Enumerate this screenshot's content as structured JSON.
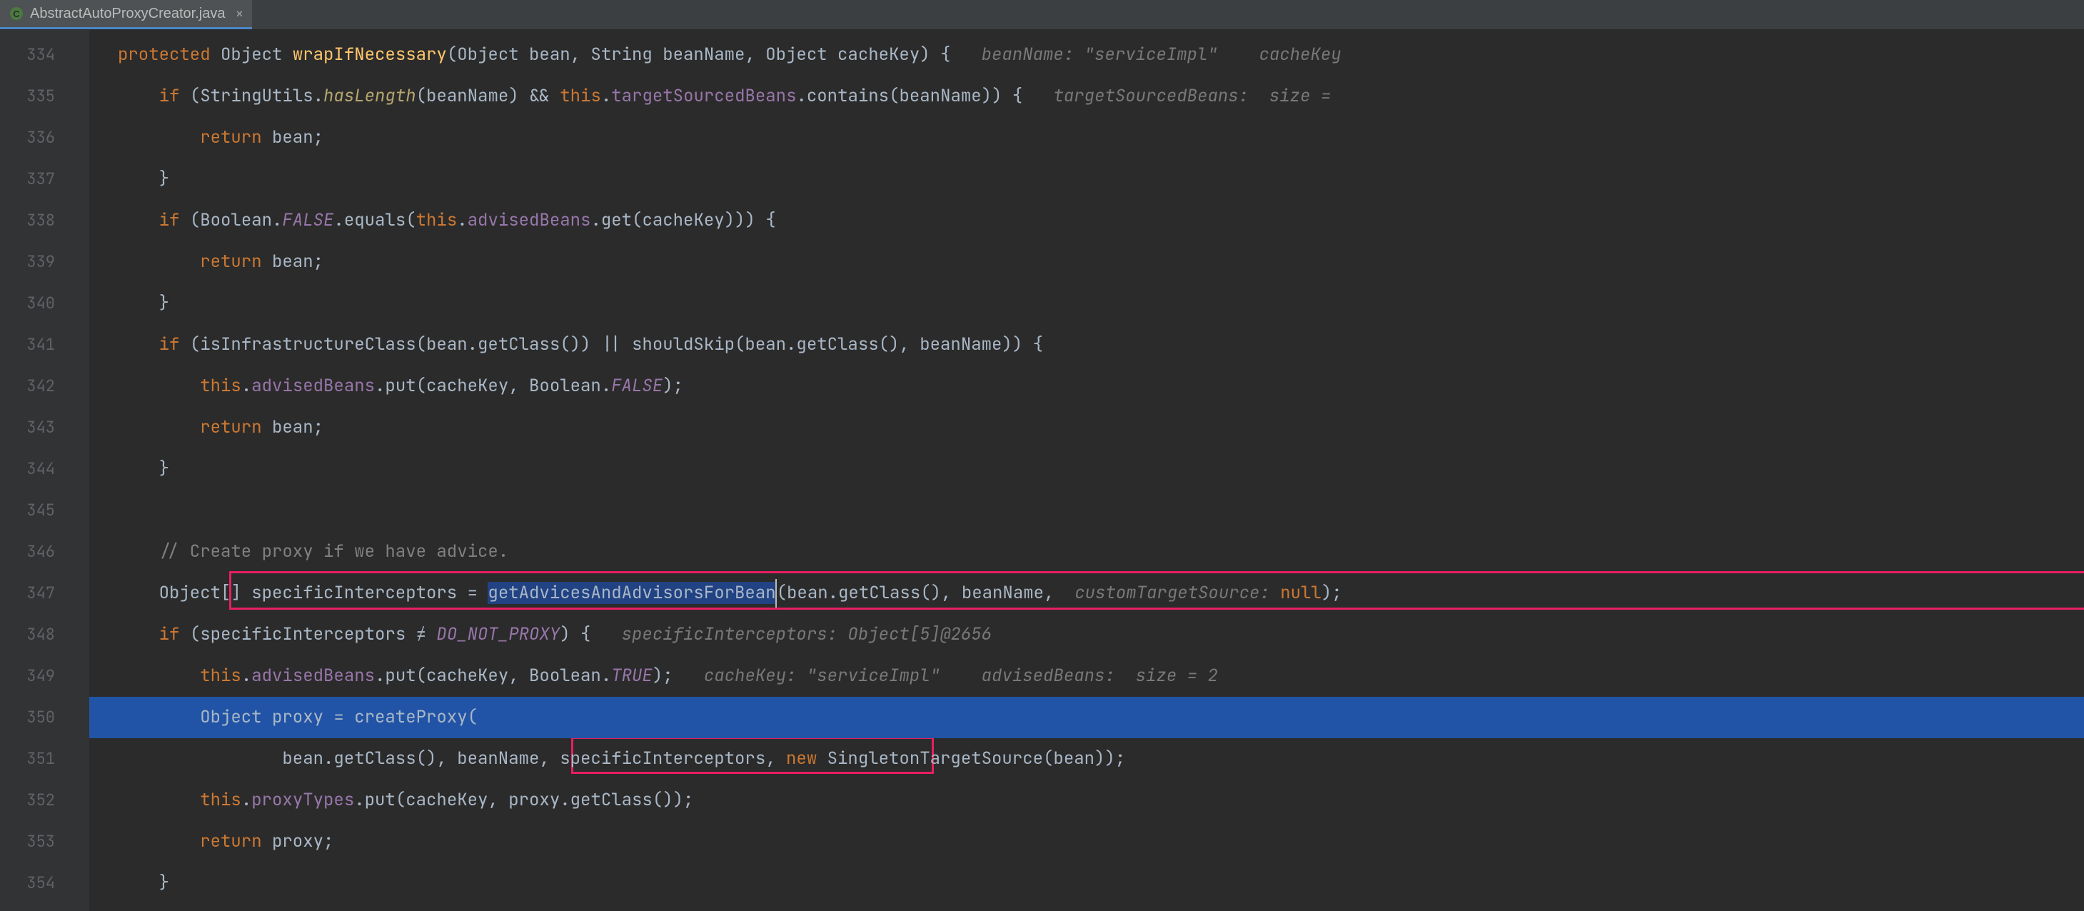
{
  "tab": {
    "filename": "AbstractAutoProxyCreator.java",
    "close_glyph": "×"
  },
  "gutter": {
    "start": 334,
    "count": 21
  },
  "code": {
    "l334": {
      "protected": "protected",
      "object": "Object",
      "method": "wrapIfNecessary",
      "sig_open": "(Object bean, String beanName, Object cacheKey) {",
      "inlay1": "   beanName: \"serviceImpl\"",
      "inlay2": "    cacheKey"
    },
    "l335": {
      "if": "if",
      "open": " (StringUtils.",
      "hasLength": "hasLength",
      "mid1": "(beanName) && ",
      "this": "this",
      "dot": ".",
      "field": "targetSourcedBeans",
      "call": ".contains(beanName)) {",
      "inlay": "   targetSourcedBeans:  size ="
    },
    "l336": {
      "return": "return",
      "bean": " bean;"
    },
    "l337": {
      "brace": "}"
    },
    "l338": {
      "if": "if",
      "open": " (Boolean.",
      "FALSE": "FALSE",
      "equals": ".equals(",
      "this": "this",
      "dot": ".",
      "field": "advisedBeans",
      "rest": ".get(cacheKey))) {"
    },
    "l339": {
      "return": "return",
      "bean": " bean;"
    },
    "l340": {
      "brace": "}"
    },
    "l341": {
      "if": "if",
      "rest": " (isInfrastructureClass(bean.getClass()) || shouldSkip(bean.getClass(), beanName)) {"
    },
    "l342": {
      "this": "this",
      "dot": ".",
      "field": "advisedBeans",
      "put": ".put(cacheKey, Boolean.",
      "FALSE": "FALSE",
      "end": ");"
    },
    "l343": {
      "return": "return",
      "bean": " bean;"
    },
    "l344": {
      "brace": "}"
    },
    "l345": {
      "blank": ""
    },
    "l346": {
      "comment": "// Create proxy if we have advice."
    },
    "l347": {
      "decl": "Object[] specificInterceptors = ",
      "sel": "getAdvicesAndAdvisorsForBean",
      "args1": "(bean.getClass(), beanName, ",
      "inlay": " customTargetSource: ",
      "null": "null",
      "end": ");"
    },
    "l348": {
      "if": "if",
      "open": " (specificInterceptors ≠ ",
      "DNP": "DO_NOT_PROXY",
      "close": ") {",
      "inlay": "   specificInterceptors: Object[5]@2656"
    },
    "l349": {
      "this": "this",
      "dot": ".",
      "field": "advisedBeans",
      "put": ".put(cacheKey, Boolean.",
      "TRUE": "TRUE",
      "end": ");",
      "inlay1": "   cacheKey: \"serviceImpl\"",
      "inlay2": "    advisedBeans:  size = 2"
    },
    "l350": {
      "decl": "Object proxy = createProxy("
    },
    "l351": {
      "args1": "bean.getClass(), beanName, ",
      "boxed": "specificInterceptors",
      "comma": ",",
      "new": " new",
      "rest": " SingletonTargetSource(bean));"
    },
    "l352": {
      "this": "this",
      "dot": ".",
      "field": "proxyTypes",
      "rest": ".put(cacheKey, proxy.getClass());"
    },
    "l353": {
      "return": "return",
      "proxy": " proxy;"
    },
    "l354": {
      "brace": "}"
    }
  }
}
